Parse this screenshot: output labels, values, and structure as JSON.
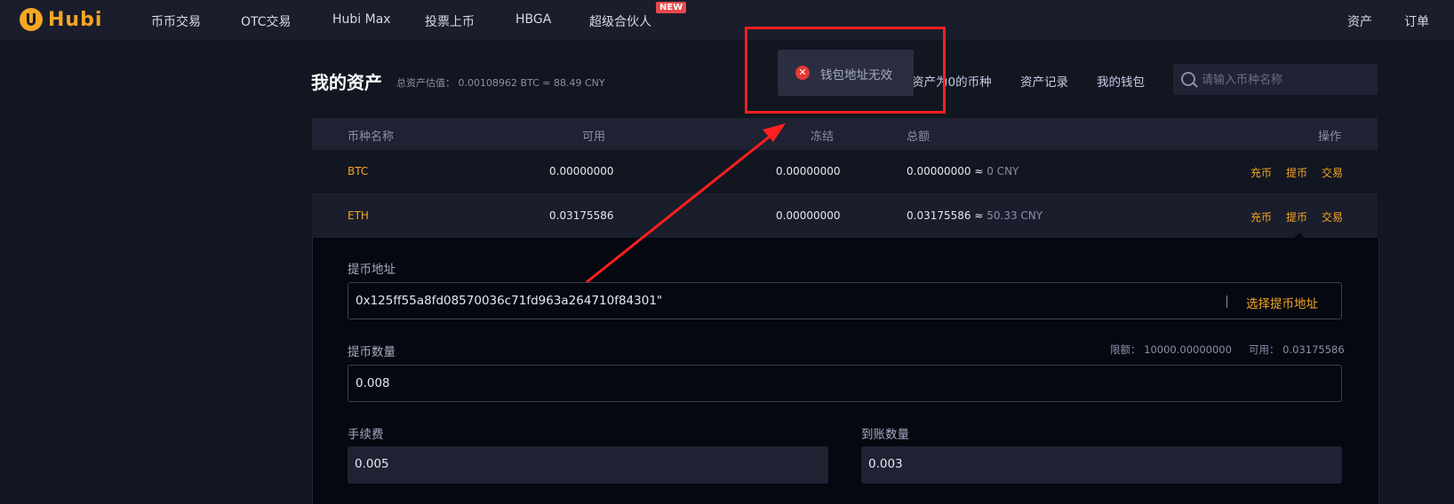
{
  "nav": {
    "logo_text": "Hubi",
    "items": [
      "币币交易",
      "OTC交易",
      "Hubi Max",
      "投票上币",
      "HBGA",
      "超级合伙人"
    ],
    "new_badge": "NEW",
    "right": [
      "资产",
      "订单"
    ]
  },
  "header": {
    "title": "我的资产",
    "total_estimate": "总资产估值： 0.00108962 BTC ≈ 88.49 CNY",
    "hide_zero": "资产为0的币种",
    "records": "资产记录",
    "wallet": "我的钱包",
    "search_placeholder": "请输入币种名称"
  },
  "table": {
    "headers": [
      "币种名称",
      "可用",
      "冻结",
      "总额",
      "操作"
    ],
    "rows": [
      {
        "coin": "BTC",
        "available": "0.00000000",
        "frozen": "0.00000000",
        "total": "0.00000000 ≈",
        "cny": "0 CNY"
      },
      {
        "coin": "ETH",
        "available": "0.03175586",
        "frozen": "0.00000000",
        "total": "0.03175586 ≈",
        "cny": "50.33 CNY"
      }
    ],
    "actions": [
      "充币",
      "提币",
      "交易"
    ]
  },
  "withdraw": {
    "address_label": "提币地址",
    "address_value": "0x125ff55a8fd08570036c71fd963a264710f84301\"",
    "choose_address": "选择提币地址",
    "amount_label": "提币数量",
    "limit": "限额： 10000.00000000",
    "available": "可用： 0.03175586",
    "amount_value": "0.008",
    "fee_label": "手续费",
    "fee_value": "0.005",
    "received_label": "到账数量",
    "received_value": "0.003"
  },
  "toast": {
    "message": "钱包地址无效",
    "icon": "error-icon"
  },
  "colors": {
    "accent": "#f5a623",
    "background": "#121621",
    "annotation": "#ff1f1f"
  }
}
